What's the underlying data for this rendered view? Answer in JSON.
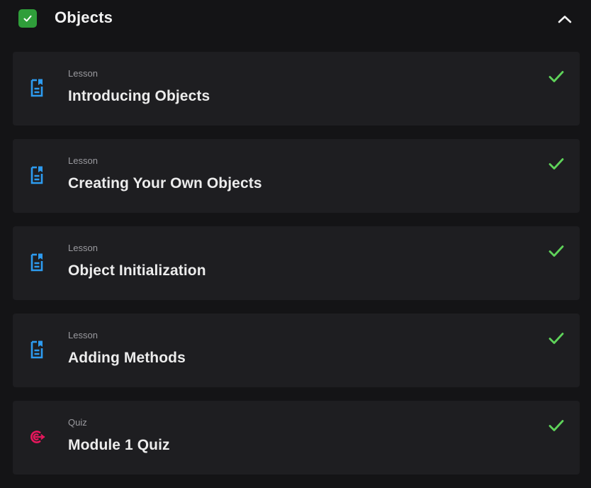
{
  "module": {
    "title": "Objects",
    "status_icon": "checkbox-checked-icon",
    "toggle_icon": "chevron-up-icon",
    "accent_color": "#2f9e3a"
  },
  "items": [
    {
      "type": "Lesson",
      "title": "Introducing Objects",
      "icon": "lesson-document-icon",
      "completed": true
    },
    {
      "type": "Lesson",
      "title": "Creating Your Own Objects",
      "icon": "lesson-document-icon",
      "completed": true
    },
    {
      "type": "Lesson",
      "title": "Object Initialization",
      "icon": "lesson-document-icon",
      "completed": true
    },
    {
      "type": "Lesson",
      "title": "Adding Methods",
      "icon": "lesson-document-icon",
      "completed": true
    },
    {
      "type": "Quiz",
      "title": "Module 1 Quiz",
      "icon": "quiz-target-icon",
      "completed": true
    }
  ],
  "colors": {
    "lesson_icon": "#2d9bf0",
    "quiz_icon": "#e8175d",
    "complete_check": "#5fd35a"
  }
}
